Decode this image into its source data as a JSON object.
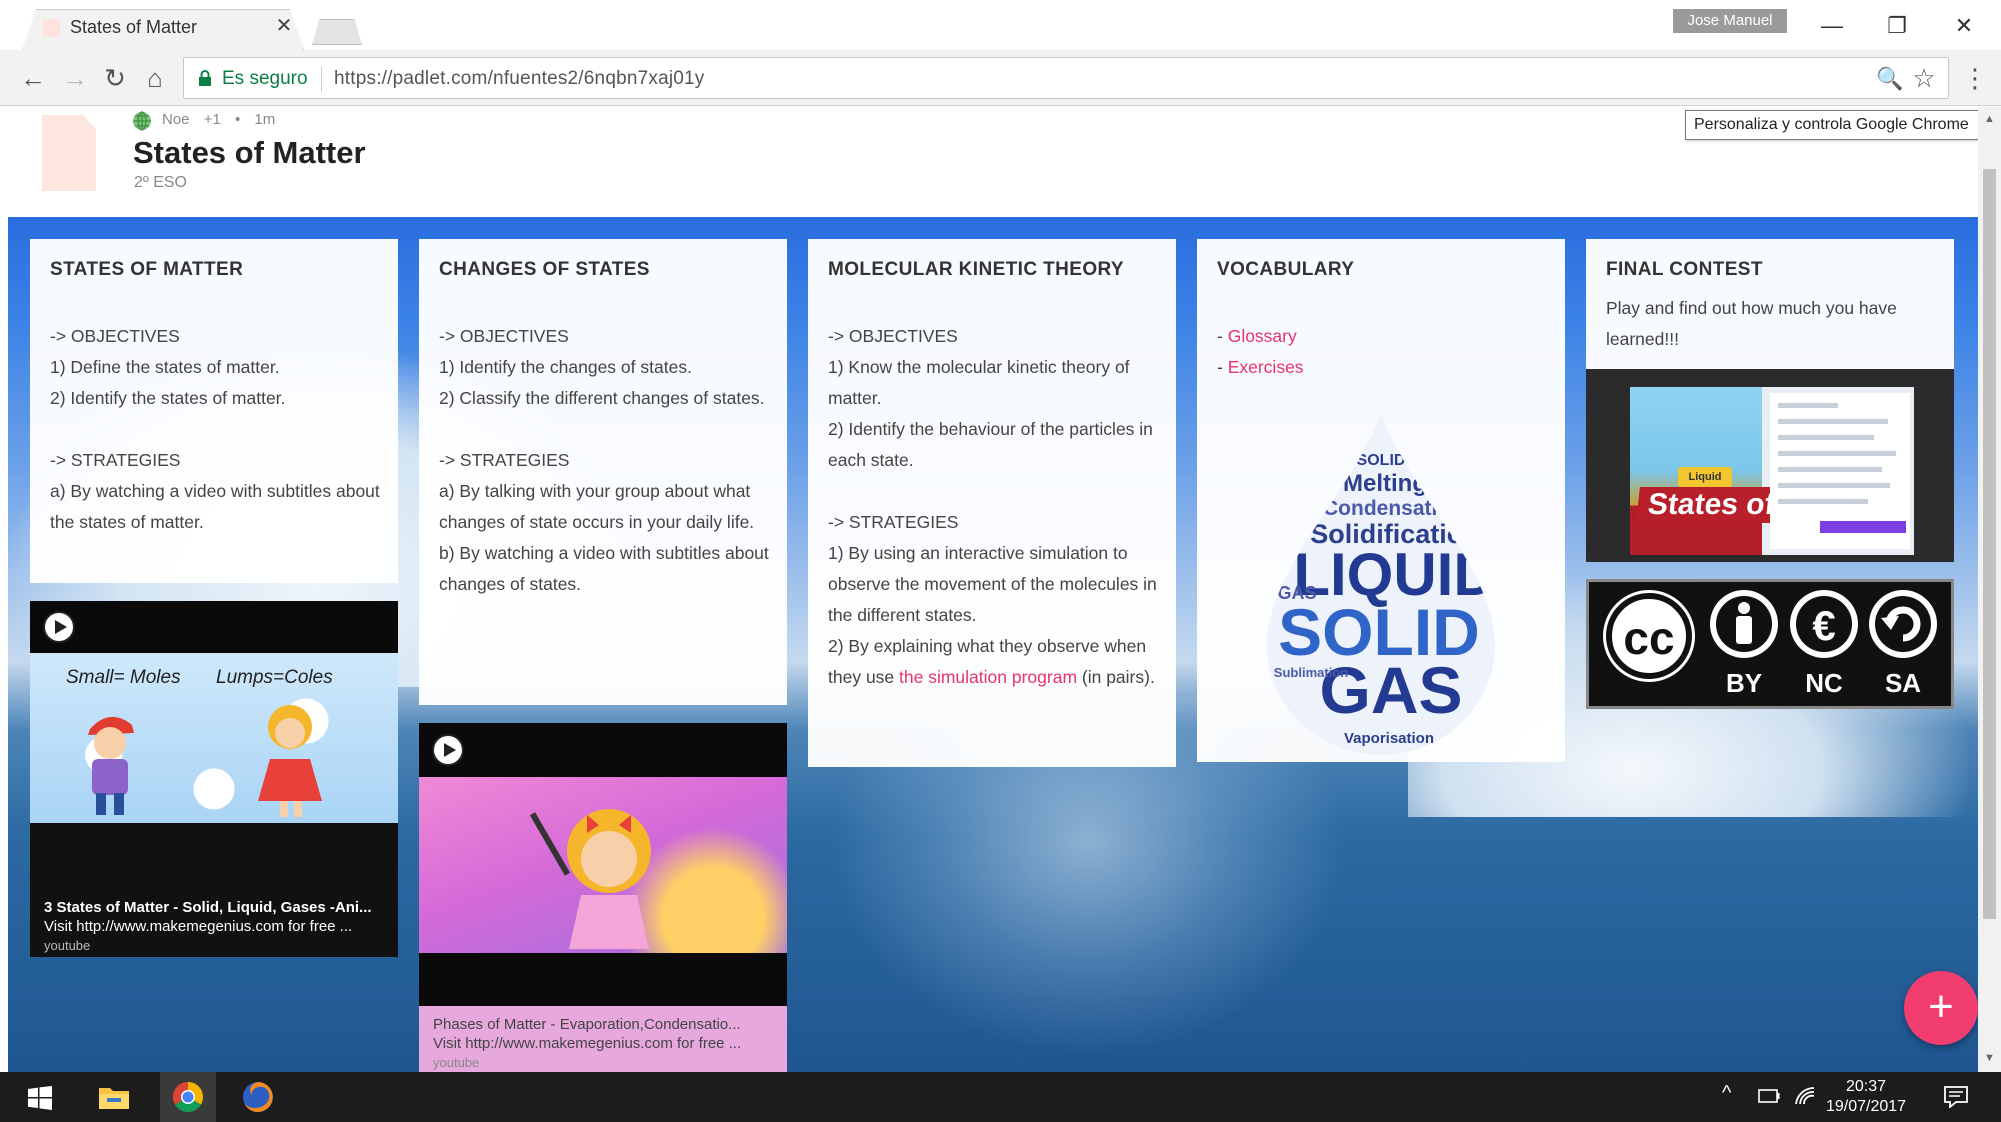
{
  "browser": {
    "tab_title": "States of Matter",
    "tab_close": "✕",
    "profile_name": "Jose Manuel",
    "window_controls": {
      "minimize": "—",
      "restore": "❐",
      "close": "✕"
    },
    "nav": {
      "back": "←",
      "forward": "→",
      "reload": "↻",
      "home": "⌂"
    },
    "secure_label": "Es seguro",
    "url": "https://padlet.com/nfuentes2/6nqbn7xaj01y",
    "zoom_icon": "🔍",
    "star_icon": "☆",
    "menu_icon": "⋮",
    "tooltip": "Personaliza y controla Google Chrome"
  },
  "padlet": {
    "author": "Noe",
    "collaborators": "+1",
    "separator": "•",
    "time_ago": "1m",
    "title": "States of Matter",
    "subtitle": "2º ESO",
    "add_button": "+"
  },
  "scrollbar": {
    "up": "▲",
    "down": "▼"
  },
  "columns": {
    "col1": {
      "title": "STATES OF MATTER",
      "lines": [
        "-> OBJECTIVES",
        "1) Define the states of matter.",
        "2) Identify the states of matter.",
        "",
        "-> STRATEGIES",
        "a) By watching a video with subtitles about the states of matter."
      ],
      "video": {
        "thumb_text_left": "Small= Moles",
        "thumb_text_right": "Lumps=Coles",
        "title": "3 States of Matter - Solid, Liquid, Gases -Ani...",
        "desc": "Visit http://www.makemegenius.com for free ...",
        "source": "youtube"
      }
    },
    "col2": {
      "title": "CHANGES OF STATES",
      "lines": [
        "-> OBJECTIVES",
        "1) Identify the changes of states.",
        "2) Classify the different changes of states.",
        "",
        "-> STRATEGIES",
        "a) By talking with your group about what changes of state occurs in your daily life.",
        "b) By watching a video with subtitles about changes of states."
      ],
      "video": {
        "title": "Phases of Matter - Evaporation,Condensatio...",
        "desc": "Visit http://www.makemegenius.com for free ...",
        "source": "youtube"
      }
    },
    "col3": {
      "title": "MOLECULAR KINETIC THEORY",
      "lines": [
        "-> OBJECTIVES",
        "1) Know the molecular kinetic theory of matter.",
        "2) Identify the behaviour of the particles in each state.",
        "",
        "-> STRATEGIES",
        "1) By using an interactive simulation to observe the movement of the molecules in the different states."
      ],
      "line_last_prefix": "2) By explaining what they observe when they use ",
      "line_last_link": "the simulation program",
      "line_last_suffix": " (in pairs)."
    },
    "col4": {
      "title": "VOCABULARY",
      "dash": "- ",
      "link_glossary": "Glossary",
      "link_exercises": "Exercises",
      "wordcloud": {
        "words": [
          "LIQUID",
          "SOLID",
          "GAS",
          "Melting",
          "Condensation",
          "Solidification",
          "Vaporisation",
          "Sublimation",
          "SOLID",
          "GAS"
        ]
      }
    },
    "col5": {
      "title": "FINAL CONTEST",
      "body": "Play and find out how much you have learned!!!",
      "game_badge": "States of",
      "game_tag": "Liquid",
      "license": {
        "cc": "cc",
        "by": "BY",
        "nc": "NC",
        "sa": "SA"
      }
    }
  },
  "taskbar": {
    "time": "20:37",
    "date": "19/07/2017",
    "chevron": "^"
  },
  "colors": {
    "link": "#e8336d",
    "secure": "#0b8043",
    "add_button": "#f23d71",
    "wall_top": "#2a6ddf"
  }
}
